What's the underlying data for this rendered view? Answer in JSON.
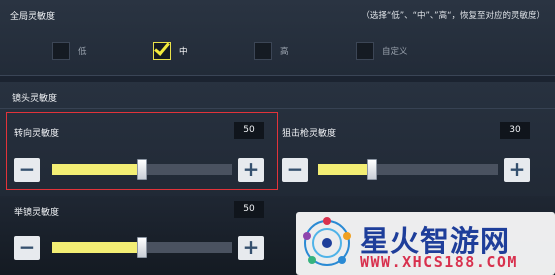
{
  "global": {
    "title": "全局灵敏度",
    "hint": "（选择“低”、“中”、”高“，恢复至对应的灵敏度）",
    "options": [
      {
        "label": "低",
        "checked": false
      },
      {
        "label": "中",
        "checked": true
      },
      {
        "label": "高",
        "checked": false
      },
      {
        "label": "自定义",
        "checked": false
      }
    ]
  },
  "lens": {
    "title": "镜头灵敏度",
    "sliders": [
      {
        "label": "转向灵敏度",
        "value": "50",
        "fraction": 0.5
      },
      {
        "label": "狙击枪灵敏度",
        "value": "30",
        "fraction": 0.3
      },
      {
        "label": "举镜灵敏度",
        "value": "50",
        "fraction": 0.5
      }
    ],
    "minus": "−",
    "plus": "+"
  },
  "watermark": {
    "title": "星火智游网",
    "url": "WWW.XHCS188.COM"
  },
  "colors": {
    "accent": "#f3ee74",
    "highlight": "#e2333a",
    "watermark_blue": "#1e3e9a",
    "watermark_red": "#d8314e"
  }
}
